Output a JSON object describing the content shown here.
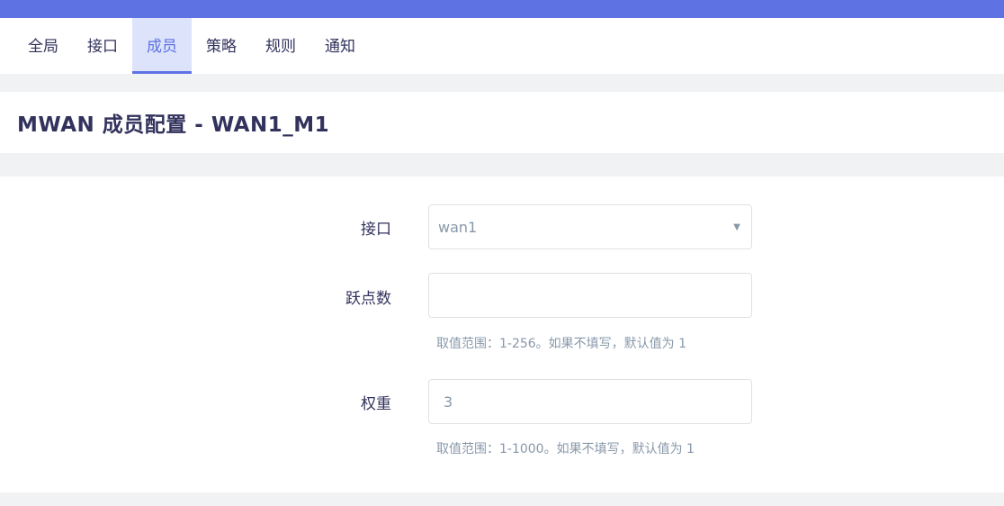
{
  "tabs": [
    {
      "label": "全局",
      "active": false
    },
    {
      "label": "接口",
      "active": false
    },
    {
      "label": "成员",
      "active": true
    },
    {
      "label": "策略",
      "active": false
    },
    {
      "label": "规则",
      "active": false
    },
    {
      "label": "通知",
      "active": false
    }
  ],
  "page": {
    "title": "MWAN 成员配置 - WAN1_M1"
  },
  "form": {
    "interface": {
      "label": "接口",
      "value": "wan1",
      "caret_icon": "caret-down-icon"
    },
    "metric": {
      "label": "跃点数",
      "value": "",
      "hint": "取值范围：1-256。如果不填写，默认值为 1"
    },
    "weight": {
      "label": "权重",
      "value": "3",
      "hint": "取值范围：1-1000。如果不填写，默认值为 1"
    }
  },
  "colors": {
    "accent": "#5e72e4",
    "active_tab_bg": "#dde3fa",
    "text_dark": "#32325d",
    "text_muted": "#8898aa"
  }
}
